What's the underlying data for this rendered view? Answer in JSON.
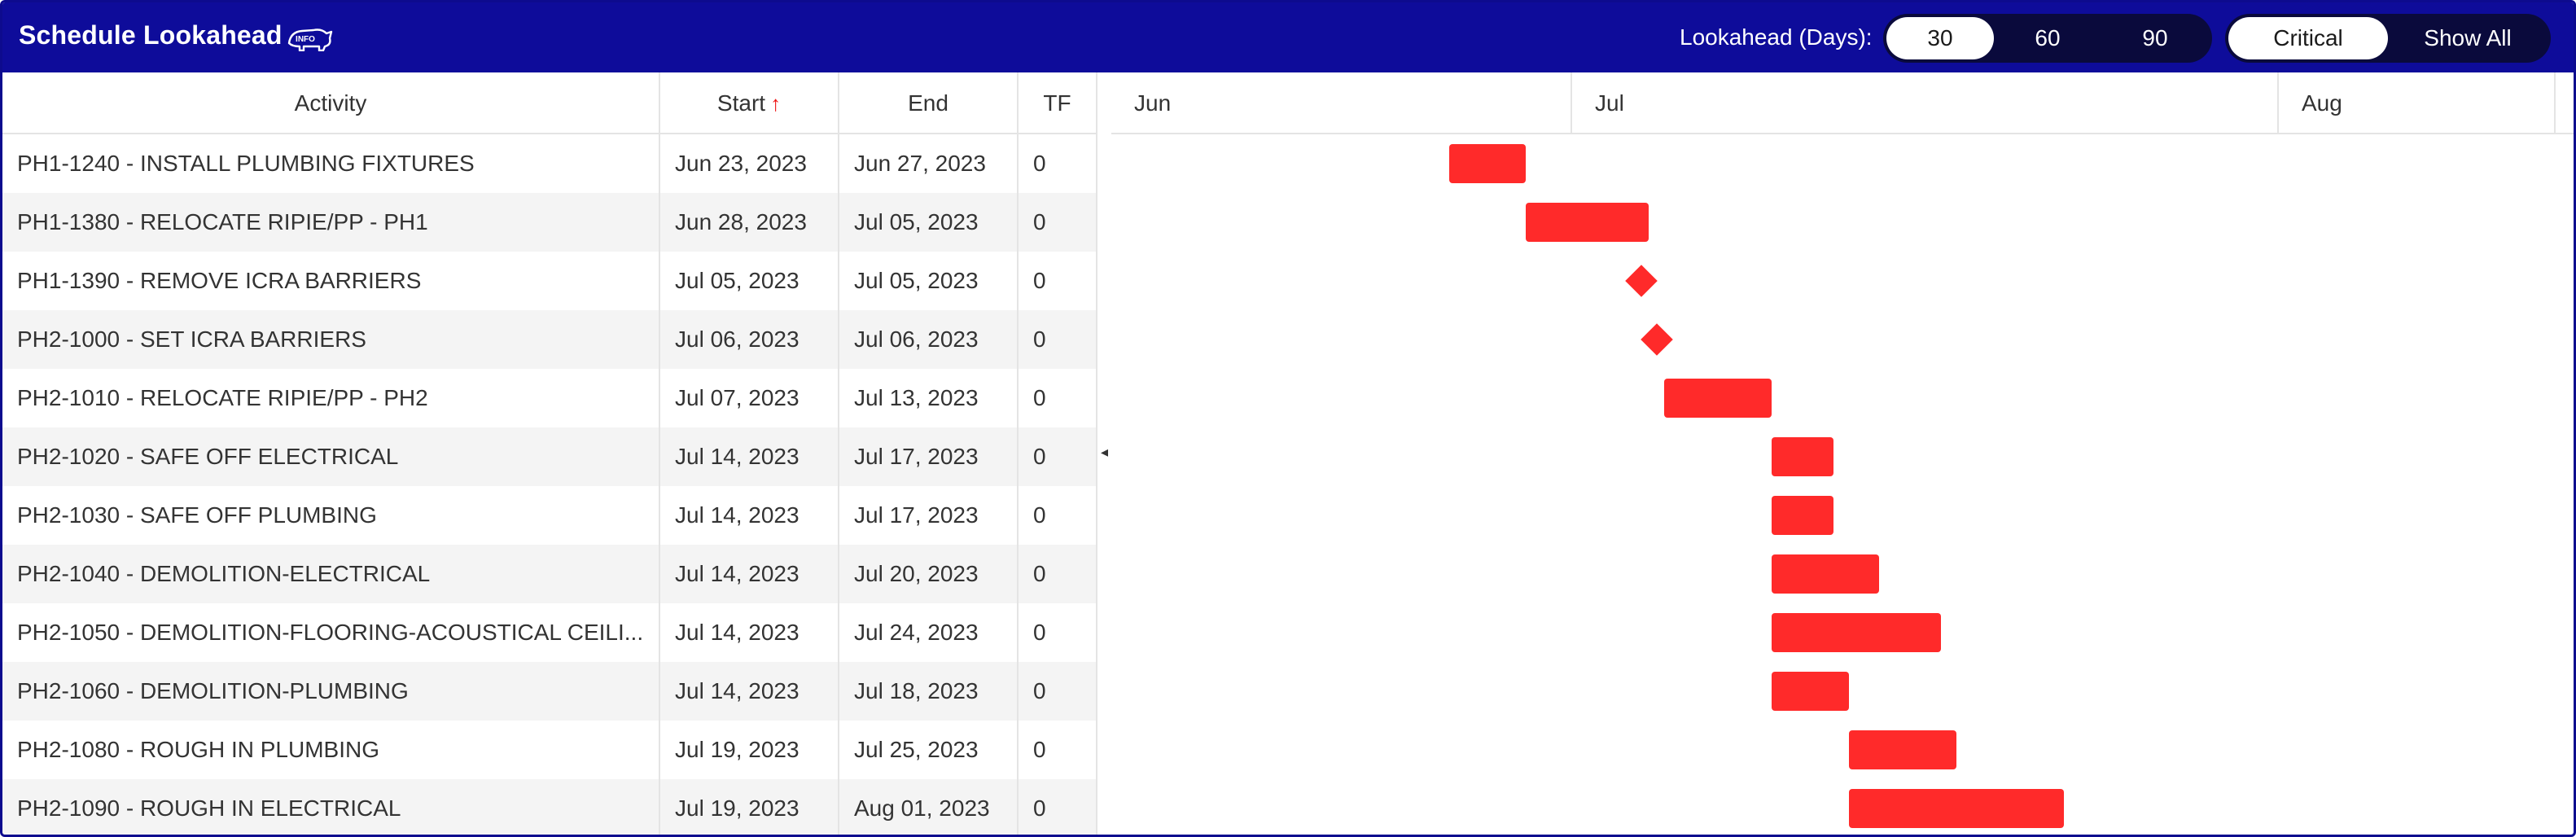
{
  "header": {
    "title": "Schedule Lookahead",
    "info_icon": "info-rhino-icon",
    "lookahead_label": "Lookahead (Days):",
    "day_options": [
      "30",
      "60",
      "90"
    ],
    "day_selected": "30",
    "mode_options": [
      "Critical",
      "Show All"
    ],
    "mode_selected": "Critical"
  },
  "table": {
    "columns": [
      "Activity",
      "Start",
      "End",
      "TF"
    ],
    "sort_column": "Start",
    "sort_direction": "ascending",
    "rows": [
      {
        "activity": "PH1-1240 - INSTALL PLUMBING FIXTURES",
        "start": "Jun 23, 2023",
        "end": "Jun 27, 2023",
        "tf": "0"
      },
      {
        "activity": "PH1-1380 - RELOCATE RIPIE/PP - PH1",
        "start": "Jun 28, 2023",
        "end": "Jul 05, 2023",
        "tf": "0"
      },
      {
        "activity": "PH1-1390 - REMOVE ICRA BARRIERS",
        "start": "Jul 05, 2023",
        "end": "Jul 05, 2023",
        "tf": "0"
      },
      {
        "activity": "PH2-1000 - SET ICRA BARRIERS",
        "start": "Jul 06, 2023",
        "end": "Jul 06, 2023",
        "tf": "0"
      },
      {
        "activity": "PH2-1010 - RELOCATE RIPIE/PP - PH2",
        "start": "Jul 07, 2023",
        "end": "Jul 13, 2023",
        "tf": "0"
      },
      {
        "activity": "PH2-1020 - SAFE OFF ELECTRICAL",
        "start": "Jul 14, 2023",
        "end": "Jul 17, 2023",
        "tf": "0"
      },
      {
        "activity": "PH2-1030 - SAFE OFF PLUMBING",
        "start": "Jul 14, 2023",
        "end": "Jul 17, 2023",
        "tf": "0"
      },
      {
        "activity": "PH2-1040 - DEMOLITION-ELECTRICAL",
        "start": "Jul 14, 2023",
        "end": "Jul 20, 2023",
        "tf": "0"
      },
      {
        "activity": "PH2-1050 - DEMOLITION-FLOORING-ACOUSTICAL CEILI...",
        "start": "Jul 14, 2023",
        "end": "Jul 24, 2023",
        "tf": "0"
      },
      {
        "activity": "PH2-1060 - DEMOLITION-PLUMBING",
        "start": "Jul 14, 2023",
        "end": "Jul 18, 2023",
        "tf": "0"
      },
      {
        "activity": "PH2-1080 - ROUGH IN PLUMBING",
        "start": "Jul 19, 2023",
        "end": "Jul 25, 2023",
        "tf": "0"
      },
      {
        "activity": "PH2-1090 - ROUGH IN ELECTRICAL",
        "start": "Jul 19, 2023",
        "end": "Aug 01, 2023",
        "tf": "0"
      }
    ]
  },
  "gantt": {
    "months": [
      "Jun",
      "Jul",
      "Aug"
    ],
    "bar_color": "#ff2a2a",
    "tasks": [
      {
        "start": "2023-06-23",
        "end": "2023-06-27",
        "milestone": false
      },
      {
        "start": "2023-06-28",
        "end": "2023-07-05",
        "milestone": false
      },
      {
        "start": "2023-07-05",
        "end": "2023-07-05",
        "milestone": true
      },
      {
        "start": "2023-07-06",
        "end": "2023-07-06",
        "milestone": true
      },
      {
        "start": "2023-07-07",
        "end": "2023-07-13",
        "milestone": false
      },
      {
        "start": "2023-07-14",
        "end": "2023-07-17",
        "milestone": false
      },
      {
        "start": "2023-07-14",
        "end": "2023-07-17",
        "milestone": false
      },
      {
        "start": "2023-07-14",
        "end": "2023-07-20",
        "milestone": false
      },
      {
        "start": "2023-07-14",
        "end": "2023-07-24",
        "milestone": false
      },
      {
        "start": "2023-07-14",
        "end": "2023-07-18",
        "milestone": false
      },
      {
        "start": "2023-07-19",
        "end": "2023-07-25",
        "milestone": false
      },
      {
        "start": "2023-07-19",
        "end": "2023-08-01",
        "milestone": false
      }
    ]
  },
  "colors": {
    "header_bg": "#0e0c9a",
    "pill_track": "#0a0a3c",
    "pill_active": "#ffffff",
    "row_alt": "#f4f4f4",
    "sort_arrow": "#ee1111"
  }
}
